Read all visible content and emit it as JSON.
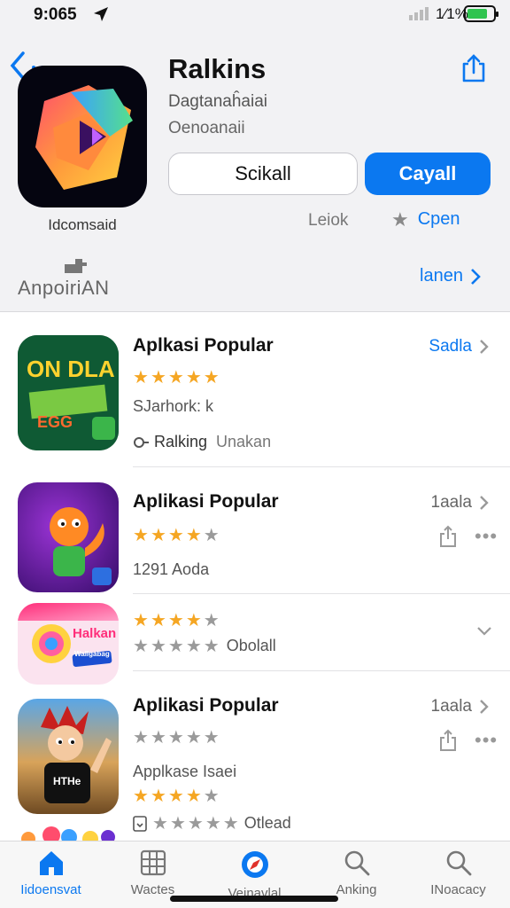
{
  "status": {
    "time": "9:065",
    "battery_pct": "1⁄1%",
    "battery_level": 0.8
  },
  "header": {
    "app_name": "Ralkins",
    "subtitle_1": "Dagtanaĥaiai",
    "subtitle_2": "Oenoanaii",
    "outline_button": "Scikall",
    "primary_button": "Cayall",
    "icon_caption": "Idcomsaid",
    "lock_label": "Leiok",
    "open_label": "Cpen",
    "footer_label": "AnpoiriAN",
    "see_all": "lanen"
  },
  "list": [
    {
      "title": "Aplkasi Popular",
      "action": "Sadla",
      "rating": 4.5,
      "line1": "SJarhork: k",
      "line2": "Ralking",
      "line2b": "Unakan"
    },
    {
      "title": "Aplikasi Popular",
      "action": "1aala",
      "rating": 4,
      "line1": "1291 Aoda"
    },
    {
      "rating_a": 4,
      "rating_b": 0,
      "line1": "Obolall"
    },
    {
      "title": "Aplikasi Popular",
      "action": "1aala",
      "rating": 0,
      "line1": "Applkase Isaei",
      "rating_b": 4,
      "rating_c": 0,
      "line2": "Otlead"
    }
  ],
  "icon_texts": {
    "row1_big": "ON DLA",
    "row1_small": "EGG",
    "row3_title": "Halkan",
    "row3_badge": "Wallgabag",
    "row4_shirt": "HTHe"
  },
  "tabs": [
    {
      "label": "Iidoensvat",
      "icon": "house-icon"
    },
    {
      "label": "Wactes",
      "icon": "grid-icon"
    },
    {
      "label": "Veinavlal",
      "icon": "compass-icon"
    },
    {
      "label": "Anking",
      "icon": "search-icon"
    },
    {
      "label": "INoacacy",
      "icon": "search-icon"
    }
  ],
  "colors": {
    "accent": "#0b78f0",
    "star": "#f5a623",
    "battery": "#2fc44f"
  }
}
